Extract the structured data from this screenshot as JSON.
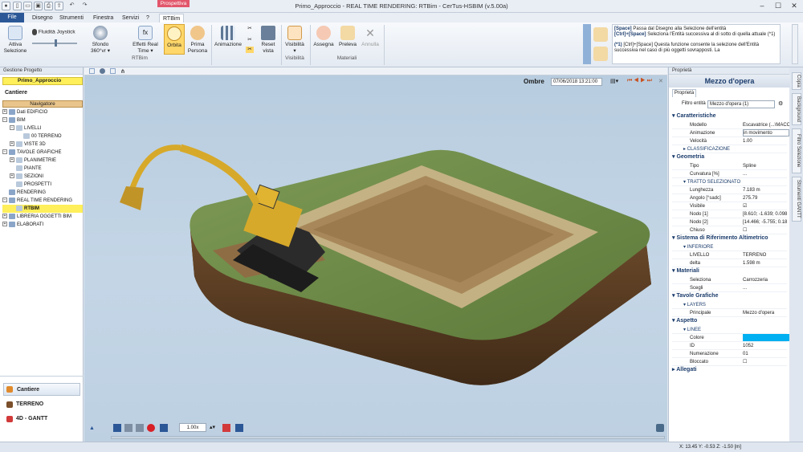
{
  "window": {
    "title": "Primo_Approccio  -  REAL TIME RENDERING: RTBim - CerTus-HSBIM (v.5.00a)",
    "context_tab": "Prospettiva",
    "min": "–",
    "max": "☐",
    "close": "✕"
  },
  "menu": {
    "file": "File",
    "items": [
      "Disegno",
      "Strumenti",
      "Finestra",
      "Servizi",
      "?",
      "RTBim"
    ]
  },
  "ribbon": {
    "buttons": [
      {
        "label": "Attiva\nSelezione",
        "icon": "cursor-icon"
      },
      {
        "label": "Fluidità Joystick",
        "icon": "joystick-icon"
      },
      {
        "label": "Sfondo\n360°vr ▾",
        "icon": "globe-icon"
      },
      {
        "label": "Effetti Real\nTime ▾",
        "icon": "fx-icon"
      },
      {
        "label": "Orbita",
        "icon": "orbit-icon"
      },
      {
        "label": "Prima\nPersona",
        "icon": "person-icon"
      },
      {
        "label": "Animazione",
        "icon": "film-icon"
      },
      {
        "label": "Reset\nvista",
        "icon": "reset-view-icon"
      },
      {
        "label": "Visibilità\n▾",
        "icon": "eye-icon"
      },
      {
        "label": "Assegna",
        "icon": "assign-icon"
      },
      {
        "label": "Preleva",
        "icon": "picker-icon"
      },
      {
        "label": "Annulla",
        "icon": "x-icon"
      }
    ],
    "groups": [
      "RTBim",
      "Visibilità",
      "Materiali"
    ]
  },
  "help": {
    "lines": [
      {
        "key": "[Space]",
        "text": "Passa dal Disegno alla Selezione dell'entità"
      },
      {
        "key": "[Ctrl]+[Space]",
        "text": "Seleziona l'Entità successiva al di sotto di quella attuale (*1)"
      },
      {
        "key": "(*1)",
        "text": "[Ctrl]+[Space]   Questa funzione consente la selezione dell'Entità successiva nel caso di più oggetti sovrapposti. La"
      }
    ]
  },
  "left": {
    "title": "Gestione Progetto",
    "project": "Primo_Approccio",
    "cantiere": "Cantiere",
    "navigator": "Navigatore",
    "tree": [
      {
        "label": "Dati EDIFICIO",
        "lvl": 0,
        "exp": "+"
      },
      {
        "label": "BIM",
        "lvl": 0,
        "exp": "−"
      },
      {
        "label": "LIVELLI",
        "lvl": 1,
        "exp": "−"
      },
      {
        "label": "00 TERRENO",
        "lvl": 2,
        "exp": ""
      },
      {
        "label": "VISTE 3D",
        "lvl": 1,
        "exp": "+"
      },
      {
        "label": "TAVOLE GRAFICHE",
        "lvl": 0,
        "exp": "−"
      },
      {
        "label": "PLANIMETRIE",
        "lvl": 1,
        "exp": "+"
      },
      {
        "label": "PIANTE",
        "lvl": 1,
        "exp": ""
      },
      {
        "label": "SEZIONI",
        "lvl": 1,
        "exp": "+"
      },
      {
        "label": "PROSPETTI",
        "lvl": 1,
        "exp": ""
      },
      {
        "label": "RENDERING",
        "lvl": 0,
        "exp": ""
      },
      {
        "label": "REAL TIME RENDERING",
        "lvl": 0,
        "exp": "−"
      },
      {
        "label": "RTBIM",
        "lvl": 1,
        "exp": "",
        "selected": true
      },
      {
        "label": "LIBRERIA OGGETTI BIM",
        "lvl": 0,
        "exp": "+"
      },
      {
        "label": "ELABORATI",
        "lvl": 0,
        "exp": "+"
      }
    ],
    "bottom_nav": [
      "Cantiere",
      "TERRENO",
      "4D - GANTT"
    ]
  },
  "viewport": {
    "ombre": "Ombre",
    "datetime": "07/06/2018  13:21:00",
    "zoom": "1.00x"
  },
  "right": {
    "title_small": "Proprietà",
    "title": "Mezzo d'opera",
    "tab": "Proprietà",
    "filter_label": "Filtro entità",
    "filter_value": "Mezzo d'opera (1)",
    "sections": [
      {
        "title": "Caratteristiche",
        "rows": [
          [
            "Modello",
            "Escavatrice  (...\\MACC"
          ],
          [
            "Animazione",
            "in movimento"
          ],
          [
            "Velocità",
            "1.00"
          ],
          [
            "▸ CLASSIFICAZIONE",
            ""
          ]
        ]
      },
      {
        "title": "Geometria",
        "rows": [
          [
            "Tipo",
            "Spline"
          ],
          [
            "Curvatura [%]",
            "..."
          ],
          [
            "▾ TRATTO SELEZIONATO",
            ""
          ],
          [
            "Lunghezza",
            "7.183 m"
          ],
          [
            "Angolo [°sadc]",
            "275.79"
          ],
          [
            "Visibile",
            "☑"
          ],
          [
            "Nodo [1]",
            "[8.610; -1.639; 0.098"
          ],
          [
            "Nodo [2]",
            "[14.466; -5.755; 0.18"
          ],
          [
            "Chiuso",
            "☐"
          ]
        ]
      },
      {
        "title": "Sistema di Riferimento Altimetrico",
        "rows": [
          [
            "▾ INFERIORE",
            ""
          ],
          [
            "LIVELLO",
            "TERRENO"
          ],
          [
            "delta",
            "1.598 m"
          ]
        ]
      },
      {
        "title": "Materiali",
        "rows": [
          [
            "Seleziona",
            "Carrozzeria"
          ],
          [
            "Scegli",
            "..."
          ]
        ]
      },
      {
        "title": "Tavole Grafiche",
        "rows": [
          [
            "▾ LAYERS",
            ""
          ],
          [
            "Principale",
            "Mezzo d'opera"
          ]
        ]
      },
      {
        "title": "Aspetto",
        "rows": [
          [
            "▾ LINEE",
            ""
          ],
          [
            "Colore",
            ""
          ],
          [
            "ID",
            "1052"
          ],
          [
            "Numerazione",
            "01"
          ],
          [
            "Bloccato",
            "☐"
          ]
        ]
      },
      {
        "title": "Allegati",
        "rows": []
      }
    ],
    "side_tabs": [
      "Copia",
      "Background",
      "Filtro Selezione",
      "Strumenti GANTT"
    ]
  },
  "status": {
    "coords": "X: 13.45   Y: -0.53   Z: -1.50  [m]"
  },
  "colors": {
    "accent": "#2b5797",
    "selected": "#ffef5a",
    "cantiere_bar": "#e9c58c",
    "colore_swatch": "#00b0f0"
  }
}
